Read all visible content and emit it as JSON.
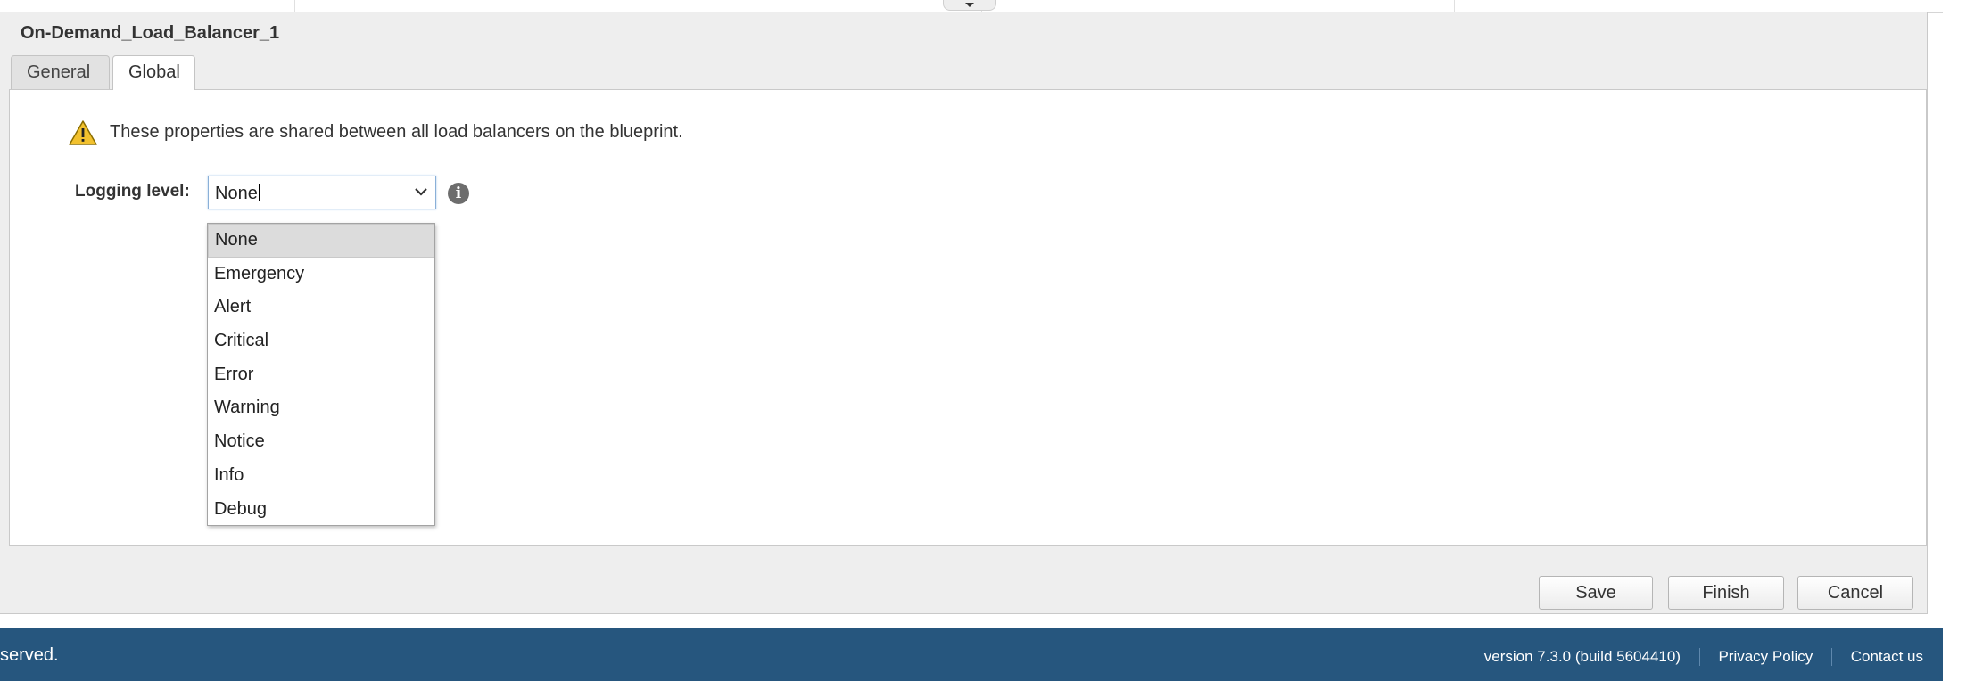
{
  "panel": {
    "title": "On-Demand_Load_Balancer_1",
    "tabs": [
      {
        "label": "General",
        "active": false
      },
      {
        "label": "Global",
        "active": true
      }
    ]
  },
  "global_tab": {
    "warning_icon": "warning-triangle-icon",
    "warning_text": "These properties are shared between all load balancers on the blueprint.",
    "logging_level": {
      "label": "Logging level:",
      "value": "None",
      "info_icon": "info-circle-icon",
      "options": [
        "None",
        "Emergency",
        "Alert",
        "Critical",
        "Error",
        "Warning",
        "Notice",
        "Info",
        "Debug"
      ],
      "highlighted_option": "None"
    }
  },
  "buttons": {
    "save": "Save",
    "finish": "Finish",
    "cancel": "Cancel"
  },
  "footer": {
    "copyright_fragment": "served.",
    "version": "version 7.3.0 (build 5604410)",
    "privacy_policy": "Privacy Policy",
    "contact_us": "Contact us",
    "background_color": "#26567e"
  }
}
